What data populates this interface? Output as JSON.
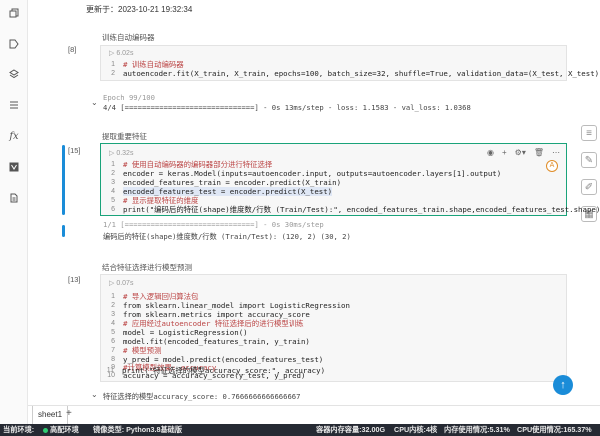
{
  "header": {
    "updated": "更新于：2023-10-21 19:32:34"
  },
  "left_icons": [
    "copy-icon",
    "tag-icon",
    "layers-icon",
    "list-icon",
    "function-icon",
    "variable-icon",
    "file-icon"
  ],
  "right_icons": [
    "notes-icon",
    "chat-icon",
    "edit-icon",
    "table-icon"
  ],
  "sections": [
    {
      "title": "训练自动编码器",
      "prompt": "[8]",
      "time": "6.02s",
      "lines": [
        {
          "n": "1",
          "text": "# 训练自动编码器",
          "kind": "cmt"
        },
        {
          "n": "2",
          "text": "autoencoder.fit(X_train, X_train, epochs=100, batch_size=32, shuffle=True, validation_data=(X_test, X_test))",
          "kind": "code"
        }
      ],
      "output": [
        "Epoch 99/100",
        "4/4 [==============================] - 0s 13ms/step - loss: 1.1583 - val_loss: 1.0368"
      ]
    },
    {
      "title": "提取重要特征",
      "prompt": "[15]",
      "time": "0.32s",
      "lines": [
        {
          "n": "1",
          "text": "# 使用自动编码器的编码器部分进行特征选择",
          "kind": "cmt"
        },
        {
          "n": "2",
          "text": "encoder = keras.Model(inputs=autoencoder.input, outputs=autoencoder.layers[1].output)",
          "kind": "code"
        },
        {
          "n": "3",
          "text": "encoded_features_train = encoder.predict(X_train)",
          "kind": "code"
        },
        {
          "n": "4",
          "text": "encoded_features_test = encoder.predict(X_test)",
          "kind": "code"
        },
        {
          "n": "5",
          "text": "# 显示提取特征的维度",
          "kind": "cmt"
        },
        {
          "n": "6",
          "text": "print(\"编码后的特征(shape)维度数/行数 (Train/Test):\", encoded_features_train.shape,encoded_features_test.shape)",
          "kind": "code"
        }
      ],
      "output": [
        "1/1 [==============================] - 0s 30ms/step",
        "编码后的特征(shape)维度数/行数 (Train/Test): (120, 2) (30, 2)"
      ]
    },
    {
      "title": "结合特征选择进行模型预测",
      "prompt": "[13]",
      "time": "0.07s",
      "lines": [
        {
          "n": "1",
          "text": "# 导入逻辑回归算法包",
          "kind": "cmt"
        },
        {
          "n": "2",
          "text": "from sklearn.linear_model import LogisticRegression",
          "kind": "code"
        },
        {
          "n": "3",
          "text": "from sklearn.metrics import accuracy_score",
          "kind": "code"
        },
        {
          "n": "4",
          "text": "# 应用经过autoencoder 特征选择后的进行模型训练",
          "kind": "cmt"
        },
        {
          "n": "5",
          "text": "model = LogisticRegression()",
          "kind": "code"
        },
        {
          "n": "6",
          "text": "model.fit(encoded_features_train, y_train)",
          "kind": "code"
        },
        {
          "n": "7",
          "text": "# 模型预测",
          "kind": "cmt"
        },
        {
          "n": "8",
          "text": "y_pred = model.predict(encoded_features_test)",
          "kind": "code"
        },
        {
          "n": "9",
          "text": "#计算模型效果: accuracy",
          "kind": "cmt"
        },
        {
          "n": "10",
          "text": "accuracy = accuracy_score(y_test, y_pred)",
          "kind": "code"
        },
        {
          "n": "11",
          "text": "print(\"特征选择的模型accuracy_score:\", accuracy)",
          "kind": "code"
        }
      ],
      "output": [
        "特征选择的模型accuracy_score: 0.7666666666666667"
      ]
    }
  ],
  "tabs": {
    "sheet": "sheet1",
    "add": "+"
  },
  "status": {
    "env_label": "当前环境:",
    "env_value": "高配环境",
    "image_label": "镜像类型: Python3.8基础版",
    "storage": "容器内存容量:32.00G",
    "cpu_cores": "CPU内核:4核",
    "mem_usage": "内存使用情况:5.31%",
    "cpu_usage": "CPU使用情况:165.37%"
  }
}
